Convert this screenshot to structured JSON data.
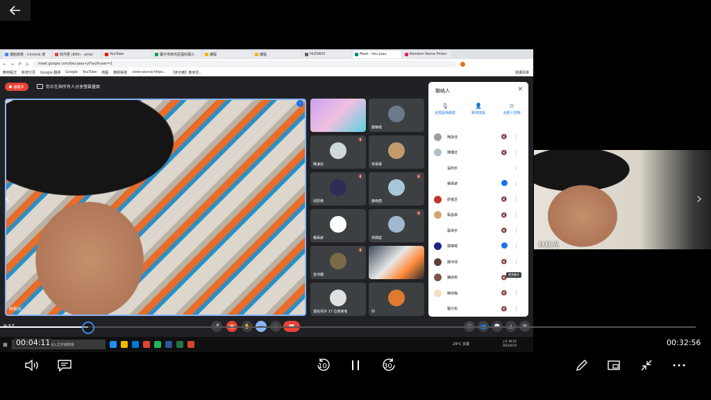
{
  "browser": {
    "tabs": [
      "爆胎搶救 - Chrome 瀏",
      "收件匣 (890) - amor",
      "YouTube",
      "臺中市西屯區福科國小",
      "課程",
      "課程",
      "HLES602",
      "Meet - kku-jaas-",
      "Random Name Picker"
    ],
    "active_tab_index": 7,
    "url": "meet.google.com/kku-jaas-ryf?authuser=1",
    "bookmarks": [
      "應用程式",
      "新增分頁",
      "Google 翻譯",
      "Google",
      "YouTube",
      "地圖",
      "教師帳號",
      "view-source:https...",
      "【參示範】教會習..."
    ],
    "bookmark_right": "閱讀清單"
  },
  "meet": {
    "rec_label": "錄製中",
    "present_note": "你正在與所有人分享螢幕畫面",
    "main_name": "林秩光",
    "tiles": [
      {
        "name": ""
      },
      {
        "name": "鄭琳曜"
      },
      {
        "name": "陳濠廷"
      },
      {
        "name": "林易霖"
      },
      {
        "name": "邱辰榮"
      },
      {
        "name": "薛雨菡"
      },
      {
        "name": "楊承諺"
      },
      {
        "name": "林姵庭"
      },
      {
        "name": "曾沛珊"
      },
      {
        "name": ""
      },
      {
        "name": "還有另外 17 位使用者"
      },
      {
        "name": "你"
      }
    ],
    "panel": {
      "title": "聯絡人",
      "actions": [
        "全部設為靜音",
        "新增成員",
        "全部人控制"
      ],
      "people": [
        "陳詠佳",
        "陳優廷",
        "張阿宇",
        "楊承諺",
        "廖寬丞",
        "蔡昌霖",
        "蔡瑋宇",
        "鄭琳曜",
        "錢沛翎",
        "鐘詠宛",
        "簡宗翰",
        "羅仔佑"
      ],
      "speaking": [
        3,
        7
      ],
      "tooltip": "更多動作"
    },
    "taskbar": {
      "search": "在這裡輸入文字來搜尋",
      "weather": "29°C 多雲",
      "time": "上午 09:52",
      "date": "2021/6/15"
    },
    "recording_time_overlay": "9:57"
  },
  "thumbnail": {
    "name": "林秩光"
  },
  "player": {
    "current_time": "00:04:11",
    "total_time": "00:32:56",
    "progress": 0.127,
    "skip_back": "10",
    "skip_forward": "30"
  }
}
